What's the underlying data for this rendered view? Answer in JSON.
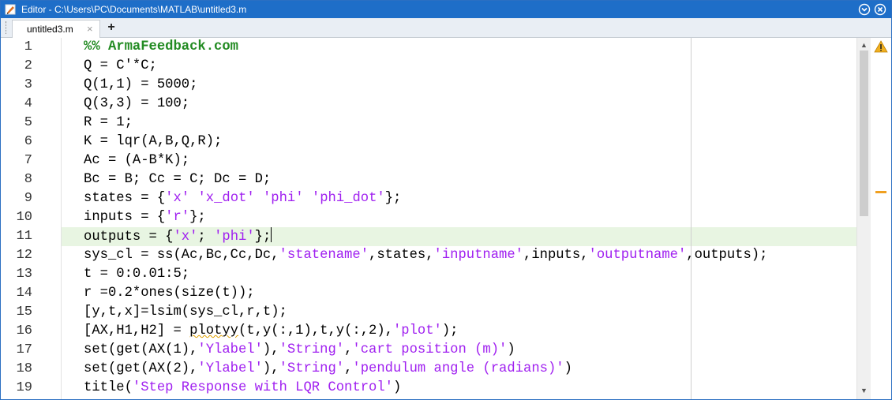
{
  "window": {
    "title": "Editor - C:\\Users\\PC\\Documents\\MATLAB\\untitled3.m"
  },
  "tabs": [
    {
      "label": "untitled3.m",
      "close_glyph": "×"
    }
  ],
  "add_tab_glyph": "+",
  "icons": {
    "app": "matlab-editor-icon",
    "menu": "chevron-down-circle-icon",
    "close": "close-circle-icon",
    "warning": "warning-triangle-icon"
  },
  "colors": {
    "titlebar": "#1e6ec8",
    "comment_cell": "#228b22",
    "string": "#a020f0",
    "current_line": "#e8f5e2",
    "warning": "#f0a020"
  },
  "editor": {
    "current_line": 11,
    "lines": [
      {
        "n": "1",
        "text": "%% ArmaFeedback.com"
      },
      {
        "n": "2",
        "text": "Q = C'*C;"
      },
      {
        "n": "3",
        "text": "Q(1,1) = 5000;"
      },
      {
        "n": "4",
        "text": "Q(3,3) = 100;"
      },
      {
        "n": "5",
        "text": "R = 1;"
      },
      {
        "n": "6",
        "text": "K = lqr(A,B,Q,R);"
      },
      {
        "n": "7",
        "text": "Ac = (A-B*K);"
      },
      {
        "n": "8",
        "text": "Bc = B; Cc = C; Dc = D;"
      },
      {
        "n": "9",
        "text": "states = {'x' 'x_dot' 'phi' 'phi_dot'};"
      },
      {
        "n": "10",
        "text": "inputs = {'r'};"
      },
      {
        "n": "11",
        "text": "outputs = {'x'; 'phi'};"
      },
      {
        "n": "12",
        "text": "sys_cl = ss(Ac,Bc,Cc,Dc,'statename',states,'inputname',inputs,'outputname',outputs);"
      },
      {
        "n": "13",
        "text": "t = 0:0.01:5;"
      },
      {
        "n": "14",
        "text": "r =0.2*ones(size(t));"
      },
      {
        "n": "15",
        "text": "[y,t,x]=lsim(sys_cl,r,t);"
      },
      {
        "n": "16",
        "text": "[AX,H1,H2] = plotyy(t,y(:,1),t,y(:,2),'plot');"
      },
      {
        "n": "17",
        "text": "set(get(AX(1),'Ylabel'),'String','cart position (m)')"
      },
      {
        "n": "18",
        "text": "set(get(AX(2),'Ylabel'),'String','pendulum angle (radians)')"
      },
      {
        "n": "19",
        "text": "title('Step Response with LQR Control')"
      }
    ]
  }
}
